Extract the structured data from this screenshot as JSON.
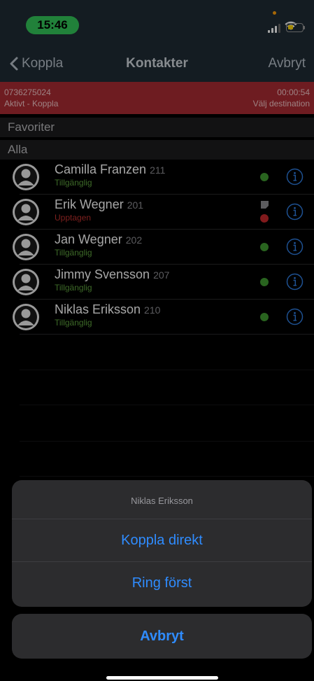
{
  "status_bar": {
    "time": "15:46",
    "icons": [
      "signal-icon",
      "wifi-icon",
      "battery-icon"
    ],
    "battery_color": "#ffd60a",
    "time_pill_color": "#34c759"
  },
  "nav": {
    "back_label": "Koppla",
    "title": "Kontakter",
    "cancel_label": "Avbryt"
  },
  "active_call": {
    "number": "0736275024",
    "state": "Aktivt - Koppla",
    "timer": "00:00:54",
    "hint": "Välj destination",
    "color": "#a92c34"
  },
  "sections": {
    "favorites": "Favoriter",
    "all": "Alla"
  },
  "contacts": [
    {
      "name": "Camilla Franzen",
      "ext": "211",
      "status": "Tillgänglig",
      "presence": "available"
    },
    {
      "name": "Erik Wegner",
      "ext": "201",
      "status": "Upptagen",
      "presence": "busy",
      "has_note": true
    },
    {
      "name": "Jan Wegner",
      "ext": "202",
      "status": "Tillgänglig",
      "presence": "available"
    },
    {
      "name": "Jimmy Svensson",
      "ext": "207",
      "status": "Tillgänglig",
      "presence": "available"
    },
    {
      "name": "Niklas Eriksson",
      "ext": "210",
      "status": "Tillgänglig",
      "presence": "available"
    }
  ],
  "action_sheet": {
    "title": "Niklas Eriksson",
    "transfer_direct": "Koppla direkt",
    "call_first": "Ring först",
    "cancel": "Avbryt"
  },
  "colors": {
    "available": "#3f9a31",
    "busy": "#c6282b",
    "action_blue": "#2f8cff"
  }
}
